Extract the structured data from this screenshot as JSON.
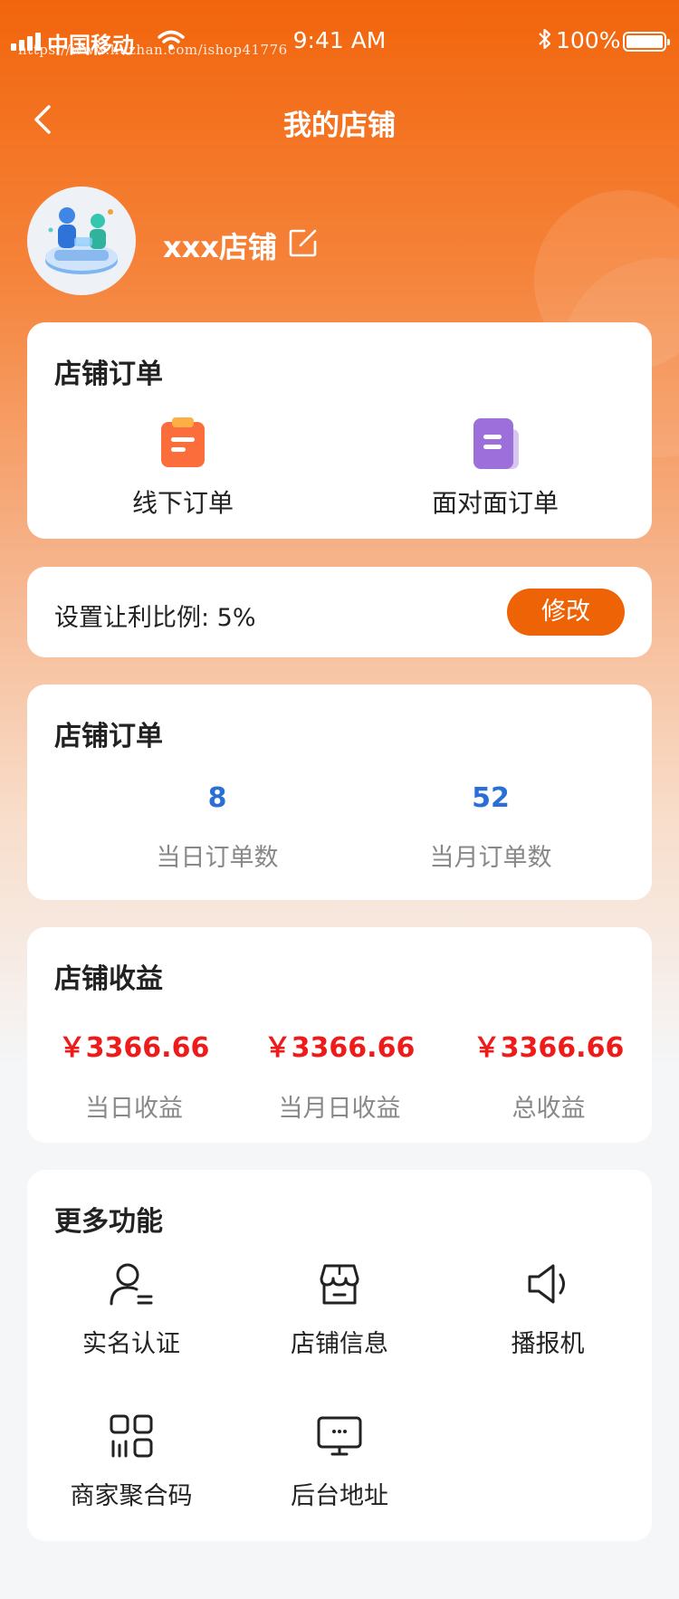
{
  "status_bar": {
    "carrier": "中国移动",
    "time": "9:41 AM",
    "battery": "100%",
    "watermark": "https://www.huzhan.com/ishop41776"
  },
  "nav": {
    "title": "我的店铺"
  },
  "shop": {
    "name": "xxx店铺"
  },
  "order_card": {
    "title": "店铺订单",
    "items": [
      {
        "label": "线下订单",
        "icon": "clipboard-icon"
      },
      {
        "label": "面对面订单",
        "icon": "document-icon"
      }
    ]
  },
  "ratio_card": {
    "label": "设置让利比例: 5%",
    "button": "修改"
  },
  "stats_card": {
    "title": "店铺订单",
    "items": [
      {
        "value": "8",
        "label": "当日订单数"
      },
      {
        "value": "52",
        "label": "当月订单数"
      }
    ]
  },
  "earnings_card": {
    "title": "店铺收益",
    "items": [
      {
        "value": "￥3366.66",
        "label": "当日收益"
      },
      {
        "value": "￥3366.66",
        "label": "当月日收益"
      },
      {
        "value": "￥3366.66",
        "label": "总收益"
      }
    ]
  },
  "more_card": {
    "title": "更多功能",
    "items": [
      {
        "label": "实名认证",
        "icon": "user-verify-icon"
      },
      {
        "label": "店铺信息",
        "icon": "store-icon"
      },
      {
        "label": "播报机",
        "icon": "speaker-icon"
      },
      {
        "label": "商家聚合码",
        "icon": "qr-code-icon"
      },
      {
        "label": "后台地址",
        "icon": "monitor-icon"
      }
    ]
  },
  "colors": {
    "accent": "#ef6307",
    "stat_blue": "#2a6fd6",
    "amount_red": "#ee1b1b"
  }
}
